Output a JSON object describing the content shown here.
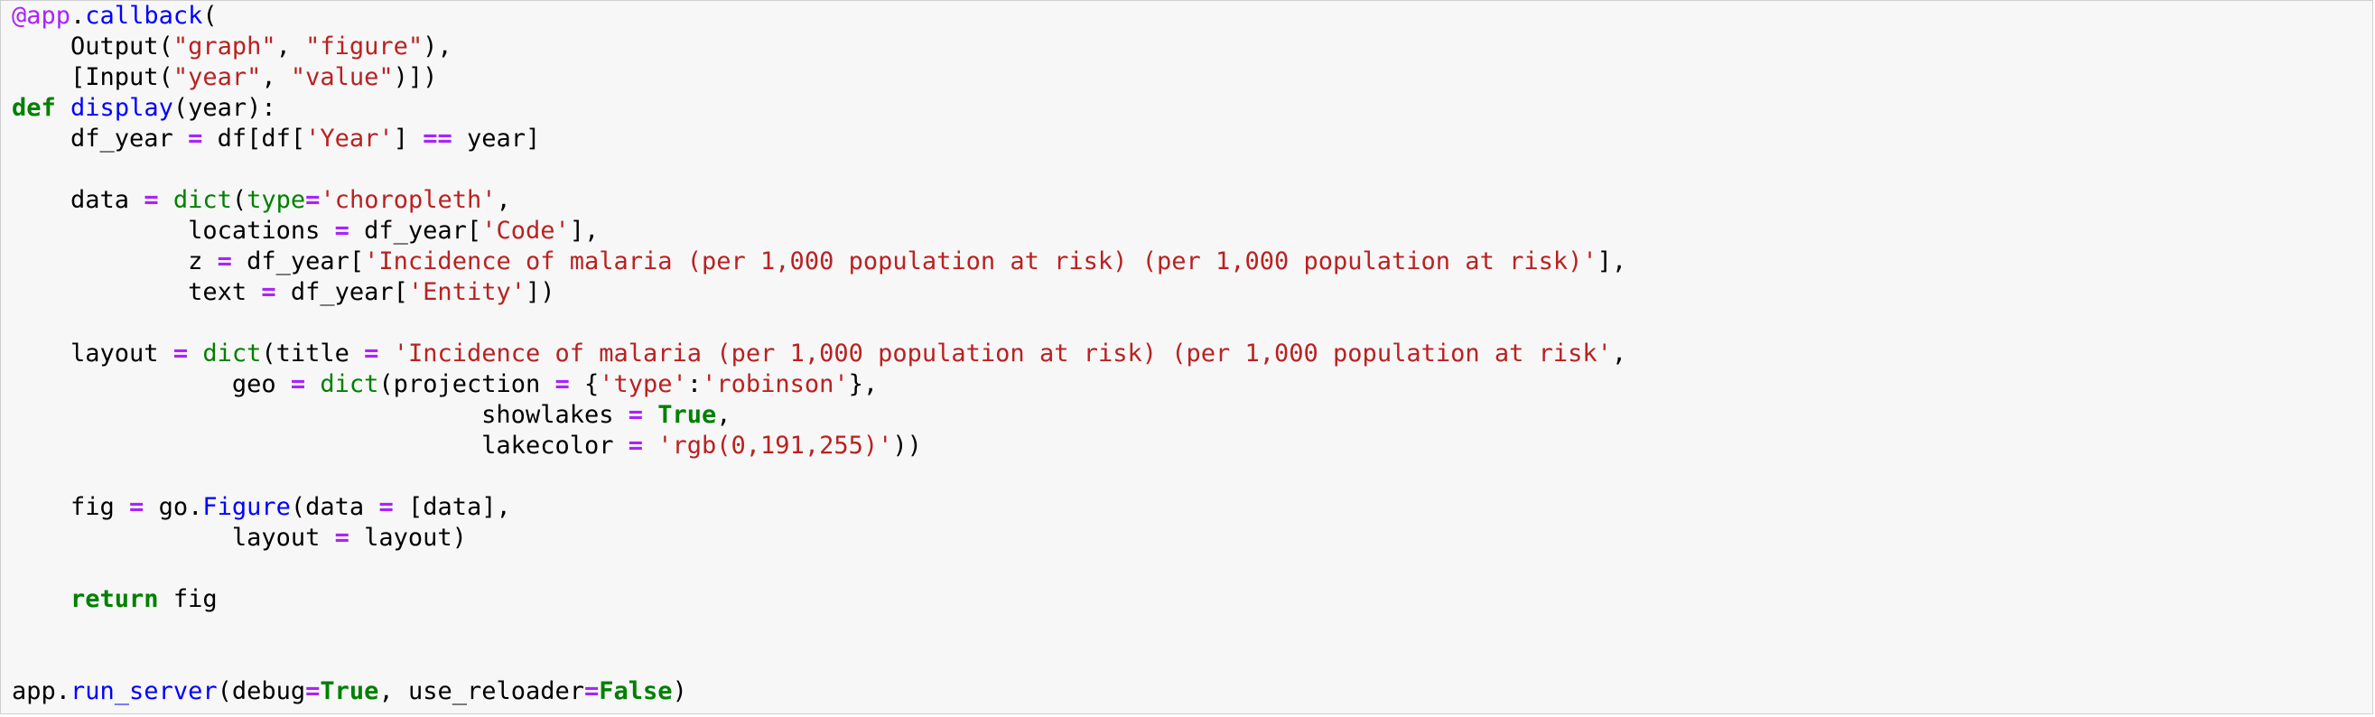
{
  "editor": {
    "language": "python",
    "colors": {
      "background": "#f7f7f7",
      "border": "#cfcfcf",
      "keyword": "#008000",
      "string": "#ba2121",
      "operator": "#aa22ff",
      "decorator": "#aa22ff",
      "function_name": "#0000ff",
      "builtin": "#008000",
      "text": "#000000"
    },
    "lines": [
      [
        [
          "dec",
          "@app"
        ],
        [
          "nm",
          "."
        ],
        [
          "fn",
          "callback"
        ],
        [
          "nm",
          "("
        ]
      ],
      [
        [
          "nm",
          "    Output("
        ],
        [
          "str",
          "\"graph\""
        ],
        [
          "nm",
          ", "
        ],
        [
          "str",
          "\"figure\""
        ],
        [
          "nm",
          "),"
        ]
      ],
      [
        [
          "nm",
          "    [Input("
        ],
        [
          "str",
          "\"year\""
        ],
        [
          "nm",
          ", "
        ],
        [
          "str",
          "\"value\""
        ],
        [
          "nm",
          ")])"
        ]
      ],
      [
        [
          "kw",
          "def"
        ],
        [
          "nm",
          " "
        ],
        [
          "fn",
          "display"
        ],
        [
          "nm",
          "(year):"
        ]
      ],
      [
        [
          "nm",
          "    df_year "
        ],
        [
          "op",
          "="
        ],
        [
          "nm",
          " df[df["
        ],
        [
          "str",
          "'Year'"
        ],
        [
          "nm",
          "] "
        ],
        [
          "op",
          "=="
        ],
        [
          "nm",
          " year]"
        ]
      ],
      [
        [
          "nm",
          ""
        ]
      ],
      [
        [
          "nm",
          "    data "
        ],
        [
          "op",
          "="
        ],
        [
          "nm",
          " "
        ],
        [
          "bi",
          "dict"
        ],
        [
          "nm",
          "("
        ],
        [
          "bi",
          "type"
        ],
        [
          "op",
          "="
        ],
        [
          "str",
          "'choropleth'"
        ],
        [
          "nm",
          ","
        ]
      ],
      [
        [
          "nm",
          "            locations "
        ],
        [
          "op",
          "="
        ],
        [
          "nm",
          " df_year["
        ],
        [
          "str",
          "'Code'"
        ],
        [
          "nm",
          "],"
        ]
      ],
      [
        [
          "nm",
          "            z "
        ],
        [
          "op",
          "="
        ],
        [
          "nm",
          " df_year["
        ],
        [
          "str",
          "'Incidence of malaria (per 1,000 population at risk) (per 1,000 population at risk)'"
        ],
        [
          "nm",
          "],"
        ]
      ],
      [
        [
          "nm",
          "            text "
        ],
        [
          "op",
          "="
        ],
        [
          "nm",
          " df_year["
        ],
        [
          "str",
          "'Entity'"
        ],
        [
          "nm",
          "])"
        ]
      ],
      [
        [
          "nm",
          ""
        ]
      ],
      [
        [
          "nm",
          "    layout "
        ],
        [
          "op",
          "="
        ],
        [
          "nm",
          " "
        ],
        [
          "bi",
          "dict"
        ],
        [
          "nm",
          "(title "
        ],
        [
          "op",
          "="
        ],
        [
          "nm",
          " "
        ],
        [
          "str",
          "'Incidence of malaria (per 1,000 population at risk) (per 1,000 population at risk'"
        ],
        [
          "nm",
          ","
        ]
      ],
      [
        [
          "nm",
          "               geo "
        ],
        [
          "op",
          "="
        ],
        [
          "nm",
          " "
        ],
        [
          "bi",
          "dict"
        ],
        [
          "nm",
          "(projection "
        ],
        [
          "op",
          "="
        ],
        [
          "nm",
          " {"
        ],
        [
          "str",
          "'type'"
        ],
        [
          "nm",
          ":"
        ],
        [
          "str",
          "'robinson'"
        ],
        [
          "nm",
          "},"
        ]
      ],
      [
        [
          "nm",
          "                                showlakes "
        ],
        [
          "op",
          "="
        ],
        [
          "nm",
          " "
        ],
        [
          "kw",
          "True"
        ],
        [
          "nm",
          ","
        ]
      ],
      [
        [
          "nm",
          "                                lakecolor "
        ],
        [
          "op",
          "="
        ],
        [
          "nm",
          " "
        ],
        [
          "str",
          "'rgb(0,191,255)'"
        ],
        [
          "nm",
          "))"
        ]
      ],
      [
        [
          "nm",
          ""
        ]
      ],
      [
        [
          "nm",
          "    fig "
        ],
        [
          "op",
          "="
        ],
        [
          "nm",
          " go."
        ],
        [
          "fn",
          "Figure"
        ],
        [
          "nm",
          "(data "
        ],
        [
          "op",
          "="
        ],
        [
          "nm",
          " [data],"
        ]
      ],
      [
        [
          "nm",
          "               layout "
        ],
        [
          "op",
          "="
        ],
        [
          "nm",
          " layout)"
        ]
      ],
      [
        [
          "nm",
          ""
        ]
      ],
      [
        [
          "nm",
          "    "
        ],
        [
          "kw",
          "return"
        ],
        [
          "nm",
          " fig"
        ]
      ],
      [
        [
          "nm",
          ""
        ]
      ],
      [
        [
          "nm",
          ""
        ]
      ],
      [
        [
          "nm",
          "app."
        ],
        [
          "fn",
          "run_server"
        ],
        [
          "nm",
          "(debug"
        ],
        [
          "op",
          "="
        ],
        [
          "kw",
          "True"
        ],
        [
          "nm",
          ", use_reloader"
        ],
        [
          "op",
          "="
        ],
        [
          "kw",
          "False"
        ],
        [
          "nm",
          ")"
        ]
      ]
    ]
  }
}
